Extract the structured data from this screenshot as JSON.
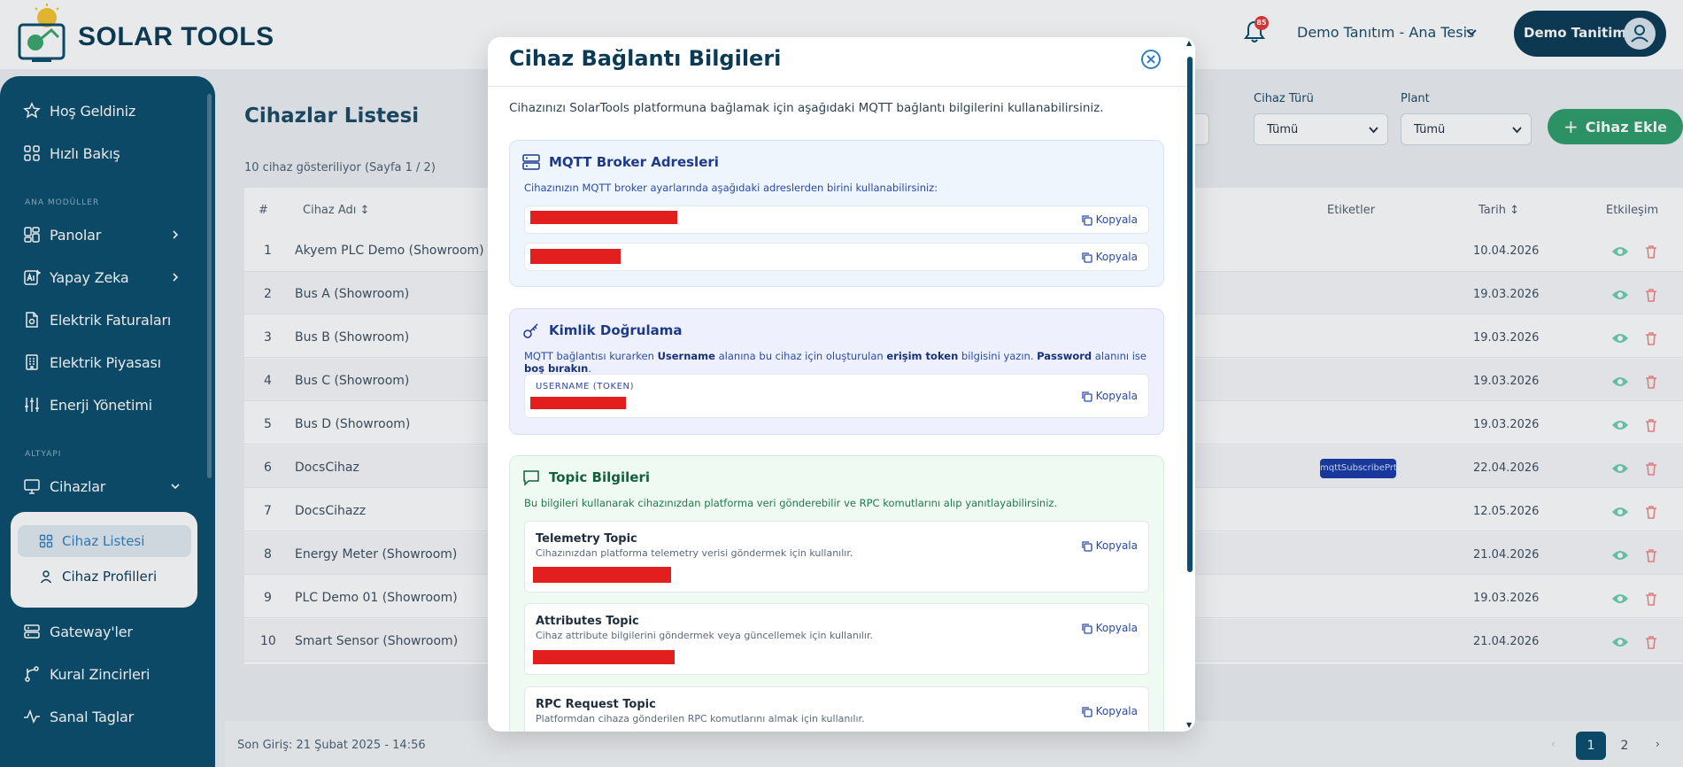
{
  "header": {
    "brand": "SOLAR TOOLS",
    "notification_count": "85",
    "tenant": "Demo Tanıtım - Ana Tesis",
    "user": "Demo Tanitim"
  },
  "sidebar": {
    "items_top": [
      {
        "label": "Hoş Geldiniz",
        "icon": "star-icon"
      },
      {
        "label": "Hızlı Bakış",
        "icon": "grid-icon"
      }
    ],
    "section_main": "ANA MODÜLLER",
    "items_main": [
      {
        "label": "Panolar",
        "icon": "dashboard-icon"
      },
      {
        "label": "Yapay Zeka",
        "icon": "ai-icon"
      },
      {
        "label": "Elektrik Faturaları",
        "icon": "invoice-icon"
      },
      {
        "label": "Elektrik Piyasası",
        "icon": "building-icon"
      },
      {
        "label": "Enerji Yönetimi",
        "icon": "sliders-icon"
      }
    ],
    "section_infra": "ALTYAPI",
    "devices": {
      "label": "Cihazlar",
      "icon": "monitor-icon"
    },
    "submenu": [
      {
        "label": "Cihaz Listesi",
        "icon": "grid-icon"
      },
      {
        "label": "Cihaz Profilleri",
        "icon": "user-icon"
      }
    ],
    "items_bottom": [
      {
        "label": "Gateway'ler",
        "icon": "server-icon"
      },
      {
        "label": "Kural Zincirleri",
        "icon": "branch-icon"
      },
      {
        "label": "Sanal Taglar",
        "icon": "pulse-icon"
      }
    ]
  },
  "main": {
    "title": "Cihazlar Listesi",
    "count_text": "10 cihaz gösteriliyor (Sayfa 1 / 2)",
    "filters": {
      "device_type_label": "Cihaz Türü",
      "device_type_value": "Tümü",
      "plant_label": "Plant",
      "plant_value": "Tümü"
    },
    "add_button": "Cihaz Ekle",
    "columns": {
      "num": "#",
      "name": "Cihaz Adı ↕",
      "tags": "Etiketler",
      "date": "Tarih ↕",
      "action": "Etkileşim"
    },
    "rows": [
      {
        "num": "1",
        "name": "Akyem PLC Demo (Showroom)",
        "date": "10.04.2026",
        "tag": ""
      },
      {
        "num": "2",
        "name": "Bus A (Showroom)",
        "date": "19.03.2026",
        "tag": ""
      },
      {
        "num": "3",
        "name": "Bus B (Showroom)",
        "date": "19.03.2026",
        "tag": ""
      },
      {
        "num": "4",
        "name": "Bus C (Showroom)",
        "date": "19.03.2026",
        "tag": ""
      },
      {
        "num": "5",
        "name": "Bus D (Showroom)",
        "date": "19.03.2026",
        "tag": ""
      },
      {
        "num": "6",
        "name": "DocsCihaz",
        "date": "22.04.2026",
        "tag": "mqttSubscribePrt"
      },
      {
        "num": "7",
        "name": "DocsCihazz",
        "date": "12.05.2026",
        "tag": ""
      },
      {
        "num": "8",
        "name": "Energy Meter (Showroom)",
        "date": "21.04.2026",
        "tag": ""
      },
      {
        "num": "9",
        "name": "PLC Demo 01 (Showroom)",
        "date": "19.03.2026",
        "tag": ""
      },
      {
        "num": "10",
        "name": "Smart Sensor (Showroom)",
        "date": "21.04.2026",
        "tag": ""
      }
    ],
    "footer_text": "Son Giriş: 21 Şubat 2025 - 14:56",
    "pages": [
      "1",
      "2"
    ]
  },
  "modal": {
    "title": "Cihaz Bağlantı Bilgileri",
    "intro": "Cihazınızı SolarTools platformuna bağlamak için aşağıdaki MQTT bağlantı bilgilerini kullanabilirsiniz.",
    "copy_label": "Kopyala",
    "broker": {
      "title": "MQTT Broker Adresleri",
      "desc": "Cihazınızın MQTT broker ayarlarında aşağıdaki adreslerden birini kullanabilirsiniz:"
    },
    "auth": {
      "title": "Kimlik Doğrulama",
      "desc_1": "MQTT bağlantısı kurarken ",
      "desc_b1": "Username",
      "desc_2": " alanına bu cihaz için oluşturulan ",
      "desc_b2": "erişim token",
      "desc_3": " bilgisini yazın. ",
      "desc_b3": "Password",
      "desc_4": " alanını ise ",
      "desc_b4": "boş bırakın",
      "desc_5": ".",
      "field_label": "USERNAME (TOKEN)"
    },
    "topics": {
      "title": "Topic Bilgileri",
      "desc": "Bu bilgileri kullanarak cihazınızdan platforma veri gönderebilir ve RPC komutlarını alıp yanıtlayabilirsiniz.",
      "items": [
        {
          "title": "Telemetry Topic",
          "desc": "Cihazınızdan platforma telemetry verisi göndermek için kullanılır."
        },
        {
          "title": "Attributes Topic",
          "desc": "Cihaz attribute bilgilerini göndermek veya güncellemek için kullanılır."
        },
        {
          "title": "RPC Request Topic",
          "desc": "Platformdan cihaza gönderilen RPC komutlarını almak için kullanılır."
        }
      ]
    }
  },
  "colors": {
    "primary": "#0b4d6e",
    "accent_green": "#2e9e6a",
    "redaction": "#e31e1e",
    "danger": "#e57373"
  }
}
